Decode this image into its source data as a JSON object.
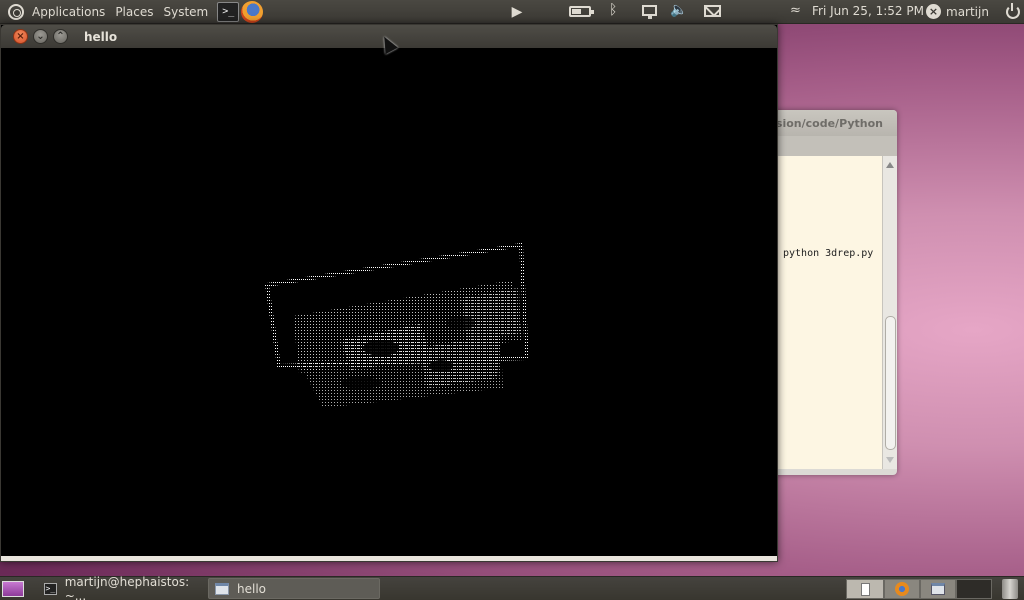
{
  "top_panel": {
    "menus": [
      "Applications",
      "Places",
      "System"
    ],
    "clock": "Fri Jun 25,  1:52 PM",
    "user": "martijn"
  },
  "background_terminal": {
    "title_fragment": "sion/code/Python",
    "command_line": "python 3drep.py"
  },
  "hello_window": {
    "title": "hello"
  },
  "bottom_panel": {
    "tasks": [
      {
        "label": "martijn@hephaistos: ~..."
      },
      {
        "label": "hello"
      }
    ]
  },
  "colors": {
    "panel": "#3b3934",
    "desktop": "#a35b86",
    "terminal_bg": "#fdf6e3",
    "close_button": "#d5502a"
  }
}
